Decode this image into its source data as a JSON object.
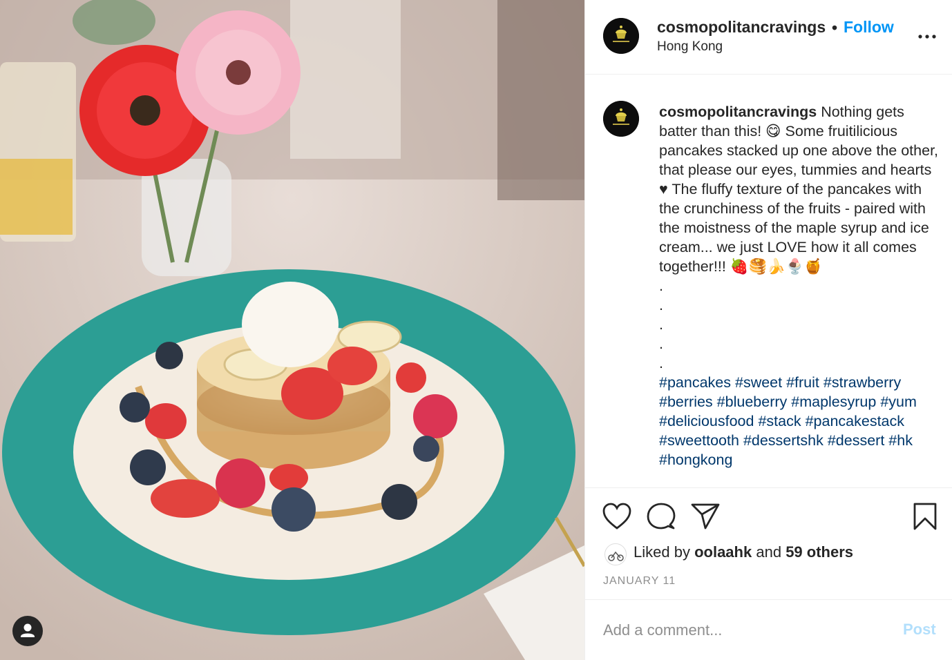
{
  "post": {
    "username": "cosmopolitancravings",
    "follow_separator": "•",
    "follow_label": "Follow",
    "location": "Hong Kong"
  },
  "caption": {
    "username": "cosmopolitancravings",
    "text": "Nothing gets batter than this! 😋 Some fruitilicious pancakes stacked up one above the other, that please our eyes, tummies and hearts ♥ The fluffy texture of the pancakes with the crunchiness of the fruits - paired with the moistness of the maple syrup and ice cream... we just LOVE how it all comes together!!! 🍓🥞🍌🍨🍯",
    "dots": ".\n.\n.\n.\n.",
    "hashtags": [
      "#pancakes",
      "#sweet",
      "#fruit",
      "#strawberry",
      "#berries",
      "#blueberry",
      "#maplesyrup",
      "#yum",
      "#deliciousfood",
      "#stack",
      "#pancakestack",
      "#sweettooth",
      "#dessertshk",
      "#dessert",
      "#hk",
      "#hongkong"
    ]
  },
  "likes": {
    "prefix": "Liked by",
    "user": "oolaahk",
    "joiner": "and",
    "others": "59 others"
  },
  "date": "JANUARY 11",
  "comment": {
    "placeholder": "Add a comment...",
    "post_label": "Post"
  },
  "icons": {
    "more": "more-options-icon",
    "like": "heart-icon",
    "comment": "comment-icon",
    "share": "share-icon",
    "save": "bookmark-icon",
    "tag": "user-tag-icon"
  },
  "colors": {
    "link_blue": "#0095f6",
    "hashtag": "#00376b",
    "muted": "#8e8e8e",
    "post_disabled": "#b2dffc"
  }
}
